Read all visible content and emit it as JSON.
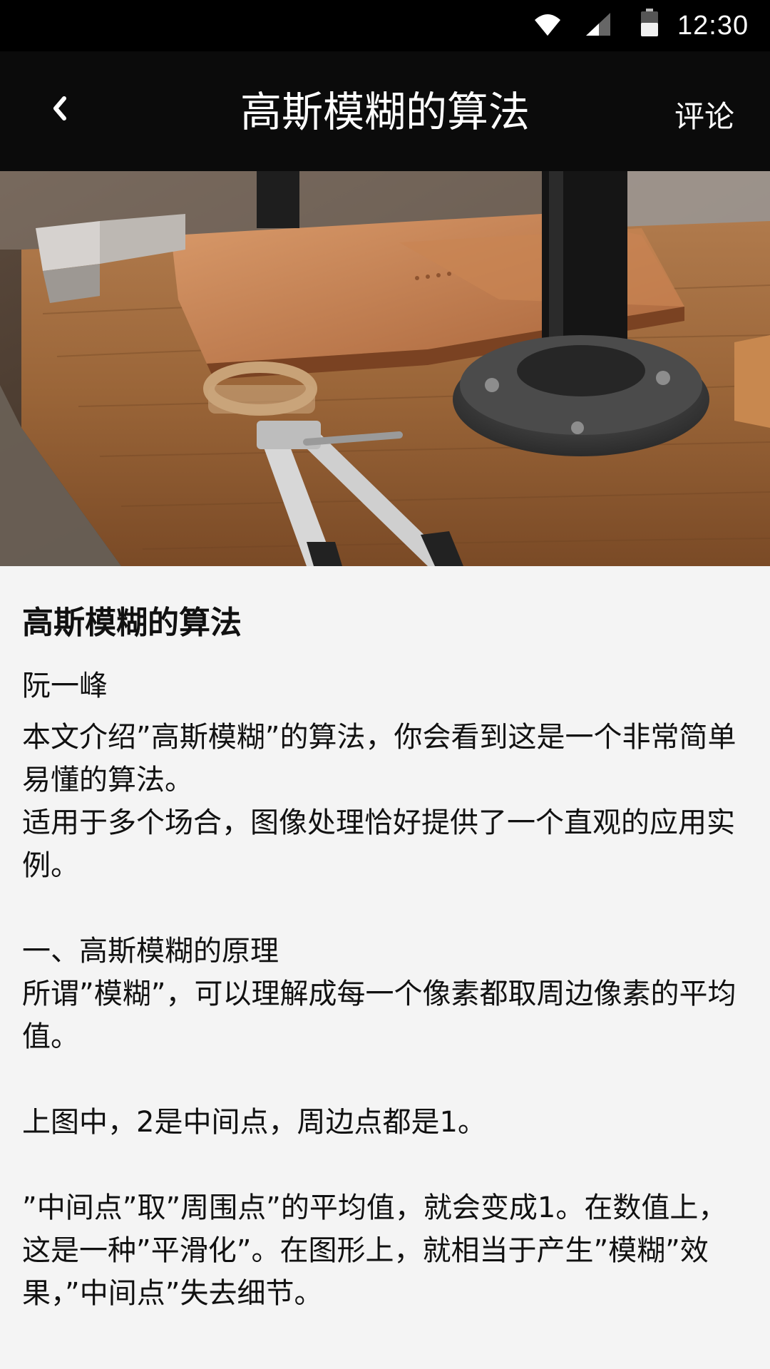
{
  "status_bar": {
    "time": "12:30",
    "icons": [
      "wifi-icon",
      "cell-signal-icon",
      "battery-icon"
    ]
  },
  "app_bar": {
    "back_icon": "chevron-left-icon",
    "title": "高斯模糊的算法",
    "comment_label": "评论"
  },
  "hero": {
    "alt_subject": "workbench-photo"
  },
  "article": {
    "headline": "高斯模糊的算法",
    "author": "阮一峰",
    "body": "本文介绍”高斯模糊”的算法，你会看到这是一个非常简单易懂的算法。\n适用于多个场合，图像处理恰好提供了一个直观的应用实例。\n\n一、高斯模糊的原理\n所谓”模糊”，可以理解成每一个像素都取周边像素的平均值。\n\n上图中，2是中间点，周边点都是1。\n\n”中间点”取”周围点”的平均值，就会变成1。在数值上，这是一种”平滑化”。在图形上，就相当于产生”模糊”效果，”中间点”失去细节。"
  },
  "colors": {
    "status_bar_bg": "#000000",
    "app_bar_bg": "#0b0b0b",
    "page_bg": "#f4f4f4",
    "text": "#111111"
  }
}
